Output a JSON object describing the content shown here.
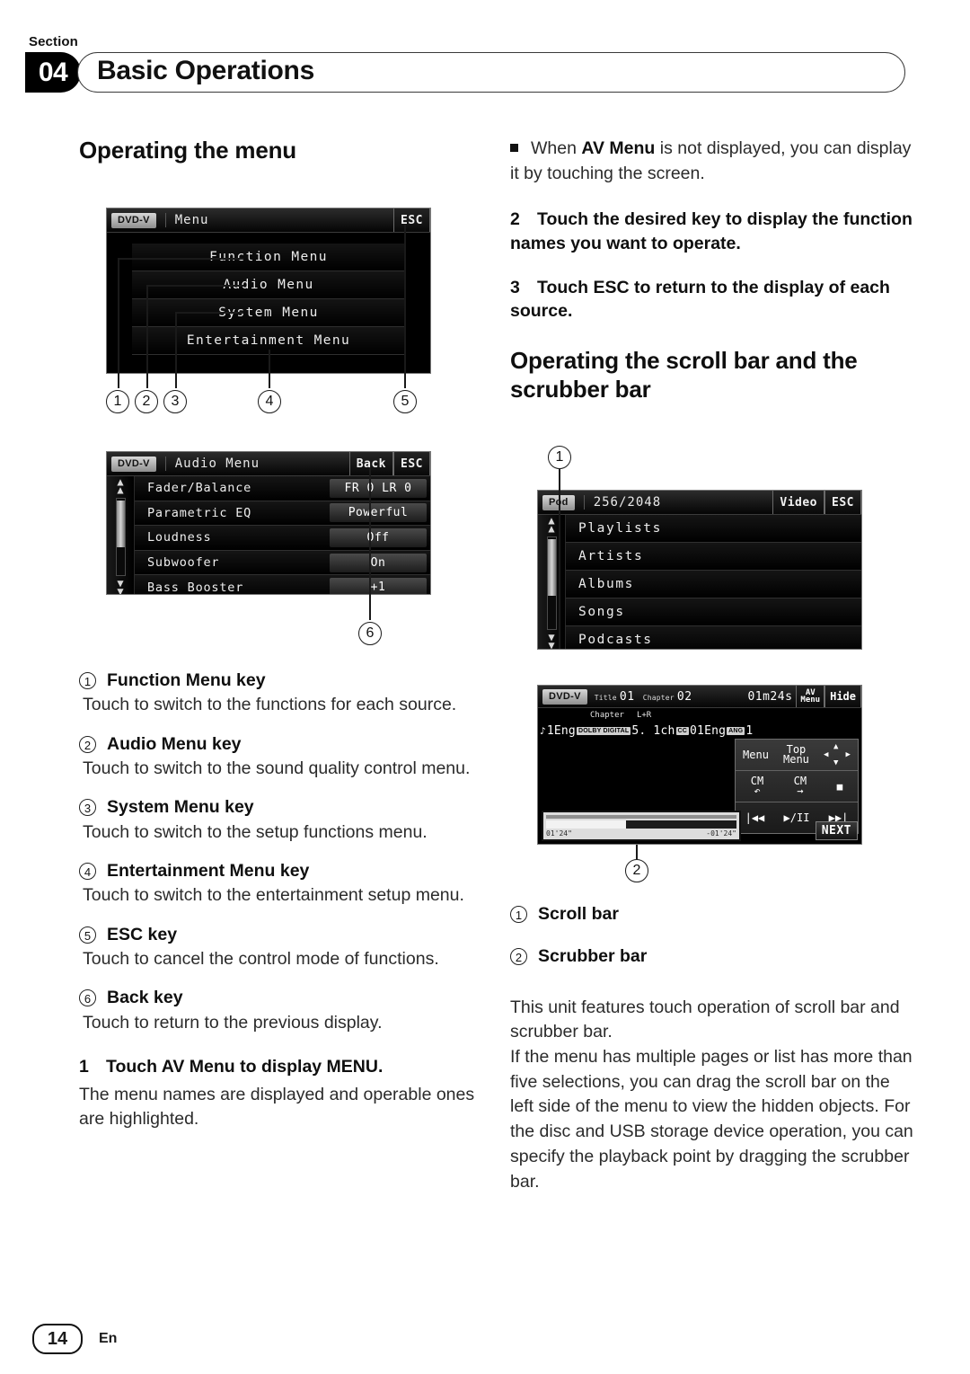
{
  "header": {
    "section_label": "Section",
    "section_number": "04",
    "title": "Basic Operations"
  },
  "left_column": {
    "heading": "Operating the menu",
    "figure_menu": {
      "source": "DVD-V",
      "title": "Menu",
      "esc_key": "ESC",
      "items": [
        "Function Menu",
        "Audio Menu",
        "System Menu",
        "Entertainment Menu"
      ],
      "callouts": [
        "1",
        "2",
        "3",
        "4",
        "5"
      ]
    },
    "figure_audio": {
      "source": "DVD-V",
      "title": "Audio Menu",
      "back_key": "Back",
      "esc_key": "ESC",
      "rows": [
        {
          "label": "Fader/Balance",
          "value": "FR 0 LR 0"
        },
        {
          "label": "Parametric EQ",
          "value": "Powerful"
        },
        {
          "label": "Loudness",
          "value": "Off"
        },
        {
          "label": "Subwoofer",
          "value": "On"
        },
        {
          "label": "Bass Booster",
          "value": "+1"
        }
      ],
      "callout": "6"
    },
    "key_items": [
      {
        "num": "1",
        "title": "Function Menu key",
        "desc": "Touch to switch to the functions for each source."
      },
      {
        "num": "2",
        "title": "Audio Menu key",
        "desc": "Touch to switch to the sound quality control menu."
      },
      {
        "num": "3",
        "title": "System Menu key",
        "desc": "Touch to switch to the setup functions menu."
      },
      {
        "num": "4",
        "title": "Entertainment Menu key",
        "desc": "Touch to switch to the entertainment setup menu."
      },
      {
        "num": "5",
        "title": "ESC key",
        "desc": "Touch to cancel the control mode of functions."
      },
      {
        "num": "6",
        "title": "Back key",
        "desc": "Touch to return to the previous display."
      }
    ],
    "step1_num": "1",
    "step1_text": "Touch AV Menu to display MENU.",
    "step1_desc": "The menu names are displayed and operable ones are highlighted."
  },
  "right_column": {
    "bullet_part1": "When ",
    "bullet_bold": "AV Menu",
    "bullet_part2": " is not displayed, you can display it by touching the screen.",
    "step2_num": "2",
    "step2_text": "Touch the desired key to display the function names you want to operate.",
    "step3_num": "3",
    "step3_text": "Touch ESC to return to the display of each source.",
    "heading": "Operating the scroll bar and the scrubber bar",
    "figure_ipod": {
      "source": "Pod",
      "title": "256/2048",
      "video_key": "Video",
      "esc_key": "ESC",
      "items": [
        "Playlists",
        "Artists",
        "Albums",
        "Songs",
        "Podcasts"
      ],
      "callout": "1"
    },
    "figure_playback": {
      "source": "DVD-V",
      "title_label": "Title",
      "title_value": "01",
      "chapter_label": "Chapter",
      "chapter_value": "02",
      "time": "01m24s",
      "av_menu_line1": "AV",
      "av_menu_line2": "Menu",
      "hide_key": "Hide",
      "sub_chapter": "Chapter",
      "sub_channel": "L+R",
      "audio_info": "1Eng",
      "audio_format": "DOLBY DIGITAL",
      "audio_channels": "5. 1ch",
      "subtitle_info": "01Eng",
      "angle_info": "1",
      "controls": {
        "menu": "Menu",
        "top_menu_line1": "Top",
        "top_menu_line2": "Menu",
        "cm_back_label": "CM",
        "cm_fwd_label": "CM",
        "prev": "|◀◀",
        "playpause": "▶/II",
        "next": "▶▶|"
      },
      "scrub_elapsed": "01'24\"",
      "scrub_remaining": "-01'24\"",
      "next_key": "NEXT",
      "callout": "2"
    },
    "key_items": [
      {
        "num": "1",
        "title": "Scroll bar"
      },
      {
        "num": "2",
        "title": "Scrubber bar"
      }
    ],
    "paragraph1": "This unit features touch operation of scroll bar and scrubber bar.",
    "paragraph2": "If the menu has multiple pages or list has more than five selections, you can drag the scroll bar on the left side of the menu to view the hidden objects. For the disc and USB storage device operation, you can specify the playback point by dragging the scrubber bar."
  },
  "footer": {
    "page": "14",
    "language": "En"
  }
}
